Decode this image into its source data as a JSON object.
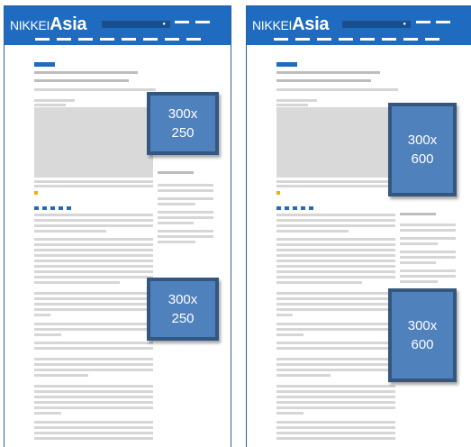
{
  "brand": {
    "nikkei": "NIKKEI",
    "asia": "Asia"
  },
  "icons": {
    "search": "search-icon"
  },
  "colors": {
    "header": "#1f6bc0",
    "ad_fill": "#4f81bd",
    "ad_border": "#35577f",
    "text_placeholder": "#d6d6d6"
  },
  "ads": {
    "left_top": {
      "line1": "300x",
      "line2": "250"
    },
    "left_bottom": {
      "line1": "300x",
      "line2": "250"
    },
    "right_top": {
      "line1": "300x",
      "line2": "600"
    },
    "right_bottom": {
      "line1": "300x",
      "line2": "600"
    }
  }
}
